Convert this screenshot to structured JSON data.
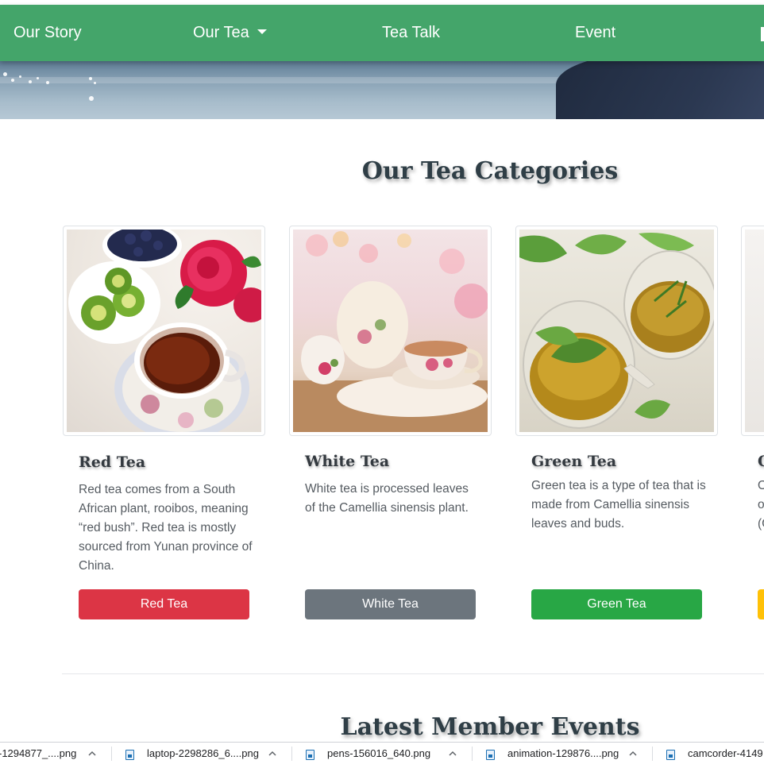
{
  "navbar": {
    "links": [
      "Our Story",
      "Our Tea",
      "Tea Talk",
      "Event"
    ],
    "bg_color": "#44a56a"
  },
  "categories_section": {
    "title": "Our Tea Categories",
    "cards": [
      {
        "title": "Red Tea",
        "text": "Red tea comes from a South African plant, rooibos, meaning “red bush”. Red tea is mostly sourced from Yunan province of China.",
        "button": "Red Tea",
        "button_color": "#dc3545"
      },
      {
        "title": "White Tea",
        "text": "White tea is processed leaves of the Camellia sinensis plant.",
        "button": "White Tea",
        "button_color": "#6c757d"
      },
      {
        "title": "Green Tea",
        "text": "Green tea is a type of tea that is made from Camellia sinensis leaves and buds.",
        "button": "Green Tea",
        "button_color": "#28a745"
      },
      {
        "title": "O",
        "text_lines": [
          "O",
          "o",
          "(C"
        ],
        "button_color": "#ffc107"
      }
    ]
  },
  "events_section": {
    "title": "Latest Member Events"
  },
  "download_bar": {
    "items": [
      "-1294877_....png",
      "laptop-2298286_6....png",
      "pens-156016_640.png",
      "animation-129876....png",
      "camcorder-4149"
    ]
  }
}
